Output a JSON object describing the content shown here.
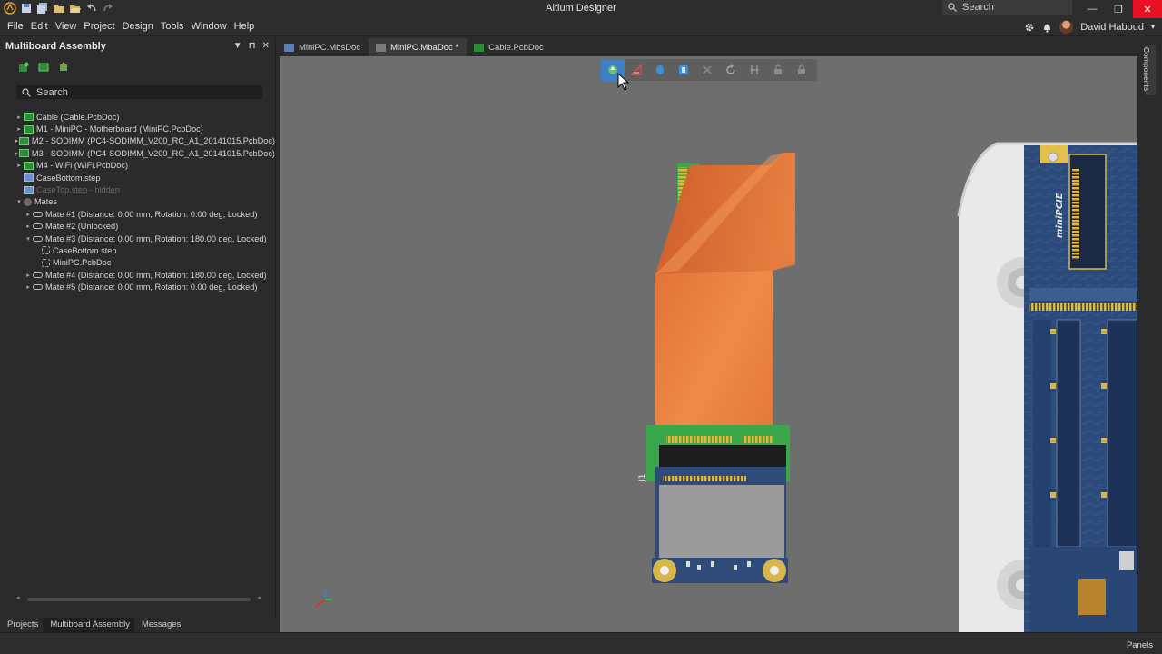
{
  "window": {
    "title": "Altium Designer",
    "search_placeholder": "Search",
    "user_name": "David Haboud"
  },
  "menu": [
    "File",
    "Edit",
    "View",
    "Project",
    "Design",
    "Tools",
    "Window",
    "Help"
  ],
  "panel": {
    "title": "Multiboard Assembly",
    "search_placeholder": "Search",
    "tree": [
      {
        "label": "Cable (Cable.PcbDoc)",
        "indent": 0,
        "twisty": "▸",
        "icon": "pcb"
      },
      {
        "label": "M1 - MiniPC - Motherboard (MiniPC.PcbDoc)",
        "indent": 0,
        "twisty": "▸",
        "icon": "pcb"
      },
      {
        "label": "M2 - SODIMM (PC4-SODIMM_V200_RC_A1_20141015.PcbDoc)",
        "indent": 0,
        "twisty": "▸",
        "icon": "pcb"
      },
      {
        "label": "M3 - SODIMM (PC4-SODIMM_V200_RC_A1_20141015.PcbDoc)",
        "indent": 0,
        "twisty": "▸",
        "icon": "pcb"
      },
      {
        "label": "M4 - WiFi (WiFi.PcbDoc)",
        "indent": 0,
        "twisty": "▸",
        "icon": "pcb"
      },
      {
        "label": "CaseBottom.step",
        "indent": 0,
        "twisty": "",
        "icon": "step"
      },
      {
        "label": "CaseTop.step - hidden",
        "indent": 0,
        "twisty": "",
        "icon": "step",
        "dim": true
      },
      {
        "label": "Mates",
        "indent": 0,
        "twisty": "▾",
        "icon": "mates"
      },
      {
        "label": "Mate #1 (Distance: 0.00 mm, Rotation: 0.00 deg, Locked)",
        "indent": 1,
        "twisty": "▸",
        "icon": "mate"
      },
      {
        "label": "Mate #2 (Unlocked)",
        "indent": 1,
        "twisty": "▸",
        "icon": "mate"
      },
      {
        "label": "Mate #3 (Distance: 0.00 mm, Rotation: 180.00 deg, Locked)",
        "indent": 1,
        "twisty": "▾",
        "icon": "mate"
      },
      {
        "label": "CaseBottom.step",
        "indent": 2,
        "twisty": "",
        "icon": "link"
      },
      {
        "label": "MiniPC.PcbDoc",
        "indent": 2,
        "twisty": "",
        "icon": "link"
      },
      {
        "label": "Mate #4 (Distance: 0.00 mm, Rotation: 180.00 deg, Locked)",
        "indent": 1,
        "twisty": "▸",
        "icon": "mate"
      },
      {
        "label": "Mate #5 (Distance: 0.00 mm, Rotation: 0.00 deg, Locked)",
        "indent": 1,
        "twisty": "▸",
        "icon": "mate"
      }
    ],
    "bottom_tabs": [
      "Projects",
      "Multiboard Assembly",
      "Messages"
    ]
  },
  "doc_tabs": [
    {
      "label": "MiniPC.MbsDoc",
      "active": false,
      "icon_color": "#5a7fb8"
    },
    {
      "label": "MiniPC.MbaDoc *",
      "active": true,
      "icon_color": "#7a7a7a"
    },
    {
      "label": "Cable.PcbDoc",
      "active": false,
      "icon_color": "#2f8a3a"
    }
  ],
  "right_strip": {
    "label": "Components"
  },
  "viewport": {
    "toolbar_icons": [
      "move-component-icon",
      "measure-icon",
      "select-body-icon",
      "mate-icon",
      "clear-icon",
      "refresh-icon",
      "align-icon",
      "lock-open-icon",
      "lock-icon"
    ],
    "silk_labels": {
      "connector": "miniPCIE",
      "ref": "J1"
    },
    "colors": {
      "background": "#6e6e6e",
      "flex_cable": "#e8773a",
      "board_green": "#3aa74a",
      "board_blue": "#2c4a7a",
      "case": "#ececec",
      "accent": "#3b7fc4"
    }
  },
  "status": {
    "panels": "Panels"
  }
}
